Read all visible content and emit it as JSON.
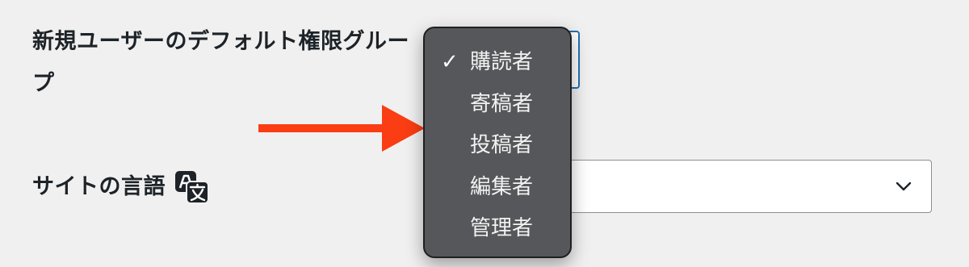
{
  "settings": {
    "default_role_label": "新規ユーザーのデフォルト権限グループ",
    "site_language_label": "サイトの言語",
    "site_language_icon": "translate-icon"
  },
  "role_dropdown": {
    "selected": "購読者",
    "check_mark": "✓",
    "options": [
      "購読者",
      "寄稿者",
      "投稿者",
      "編集者",
      "管理者"
    ]
  },
  "language_select": {
    "icon": "chevron-down-icon"
  },
  "annotation": {
    "arrow_color": "#fa3d13"
  },
  "colors": {
    "background": "#f0f0f1",
    "popup_background": "#56575a",
    "focus_border": "#2271b1"
  }
}
